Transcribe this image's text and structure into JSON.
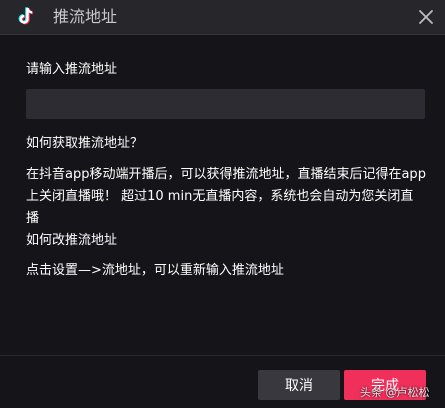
{
  "window": {
    "title": "推流地址",
    "logo_icon": "tiktok-logo-icon",
    "close_icon": "close-icon"
  },
  "form": {
    "input_label": "请输入推流地址",
    "input_value": "",
    "input_placeholder": ""
  },
  "help": {
    "how_get_title": "如何获取推流地址？",
    "how_get_text": "在抖音app移动端开播后，可以获得推流地址，直播结束后记得在app上关闭直播哦！ 超过10 min无直播内容，系统也会自动为您关闭直播",
    "how_change_title": "如何改推流地址",
    "how_change_text": "点击设置—>流地址，可以重新输入推流地址"
  },
  "footer": {
    "cancel_label": "取消",
    "done_label": "完成"
  },
  "watermark": {
    "text": "头条 @卢松松"
  },
  "colors": {
    "background": "#151519",
    "titlebar": "#26262b",
    "input_bg": "#2c2c32",
    "cancel_bg": "#38383e",
    "accent": "#f12f5b"
  }
}
